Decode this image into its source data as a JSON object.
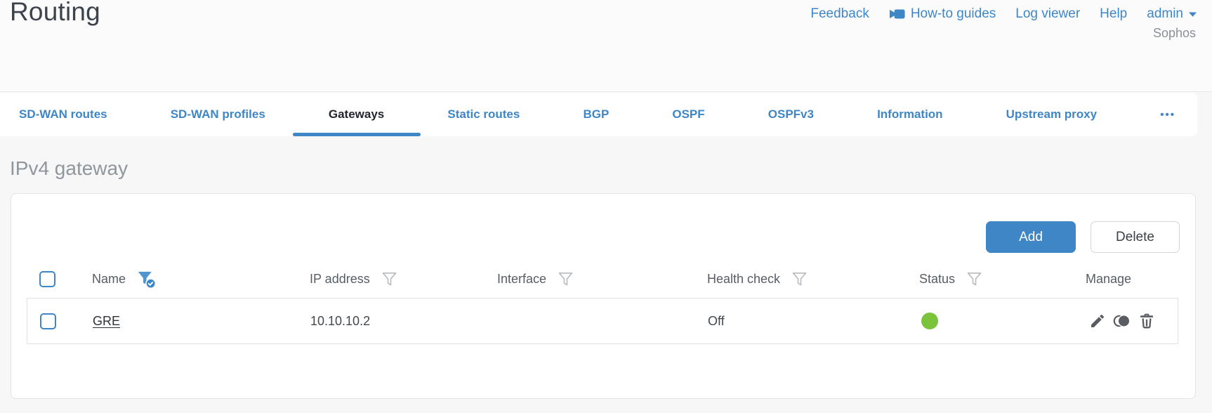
{
  "page": {
    "title": "Routing",
    "vendor": "Sophos"
  },
  "top_nav": {
    "feedback": "Feedback",
    "howto_guides": "How-to guides",
    "log_viewer": "Log viewer",
    "help": "Help",
    "user": "admin"
  },
  "tabs": {
    "items": [
      {
        "label": "SD-WAN routes",
        "active": false
      },
      {
        "label": "SD-WAN profiles",
        "active": false
      },
      {
        "label": "Gateways",
        "active": true
      },
      {
        "label": "Static routes",
        "active": false
      },
      {
        "label": "BGP",
        "active": false
      },
      {
        "label": "OSPF",
        "active": false
      },
      {
        "label": "OSPFv3",
        "active": false
      },
      {
        "label": "Information",
        "active": false
      },
      {
        "label": "Upstream proxy",
        "active": false
      }
    ],
    "more": "•••"
  },
  "section": {
    "heading": "IPv4 gateway"
  },
  "toolbar": {
    "add": "Add",
    "delete": "Delete"
  },
  "table": {
    "columns": {
      "name": "Name",
      "ip": "IP address",
      "interface": "Interface",
      "health": "Health check",
      "status": "Status",
      "manage": "Manage"
    },
    "filters": {
      "name": "active",
      "ip": "inactive",
      "interface": "inactive",
      "health": "inactive",
      "status": "inactive"
    },
    "rows": [
      {
        "name": "GRE",
        "ip": "10.10.10.2",
        "interface": "",
        "health_check": "Off",
        "status": "up"
      }
    ]
  },
  "colors": {
    "accent_blue": "#3e86c6",
    "status_green": "#7cc33c",
    "icon_gray": "#595d61"
  }
}
